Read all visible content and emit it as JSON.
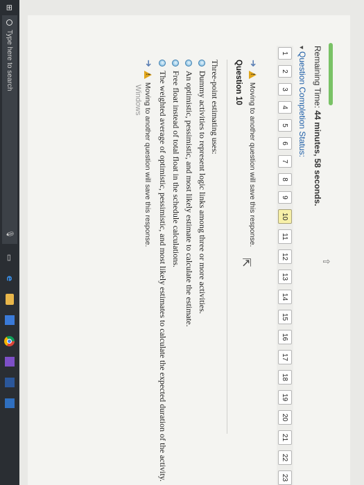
{
  "timer": {
    "label": "Remaining Time:",
    "value": "44 minutes, 58 seconds."
  },
  "status": {
    "label": "Question Completion Status:",
    "questions": [
      "1",
      "2",
      "3",
      "4",
      "5",
      "6",
      "7",
      "8",
      "9",
      "10",
      "11",
      "12",
      "13",
      "14",
      "15",
      "16",
      "17",
      "18",
      "19",
      "20",
      "21",
      "22",
      "23"
    ],
    "current_question": "10"
  },
  "warning_top": "Moving to another question will save this response.",
  "question": {
    "title": "Question 10",
    "prompt": "Three-point estimating uses:",
    "options": [
      "Dummy activities to represent logic links among three or more activities.",
      "An optimistic, pessimistic, and most likely estimate to calculate the estimate.",
      "Free float instead of total float in the schedule calculations.",
      "The weighted average of optimistic, pessimistic, and most likely estimates to calculate the expected duration of the activity."
    ]
  },
  "warning_bottom": "Moving to another question will save this response.",
  "watermark": "Windows",
  "taskbar": {
    "search_placeholder": "Type here to search"
  },
  "colors": {
    "progress": "#79c266",
    "link_blue": "#1f5fa8",
    "current_question_bg": "#f7f0a8",
    "warning_yellow": "#e0a51b",
    "taskbar": "#2a2e33"
  }
}
